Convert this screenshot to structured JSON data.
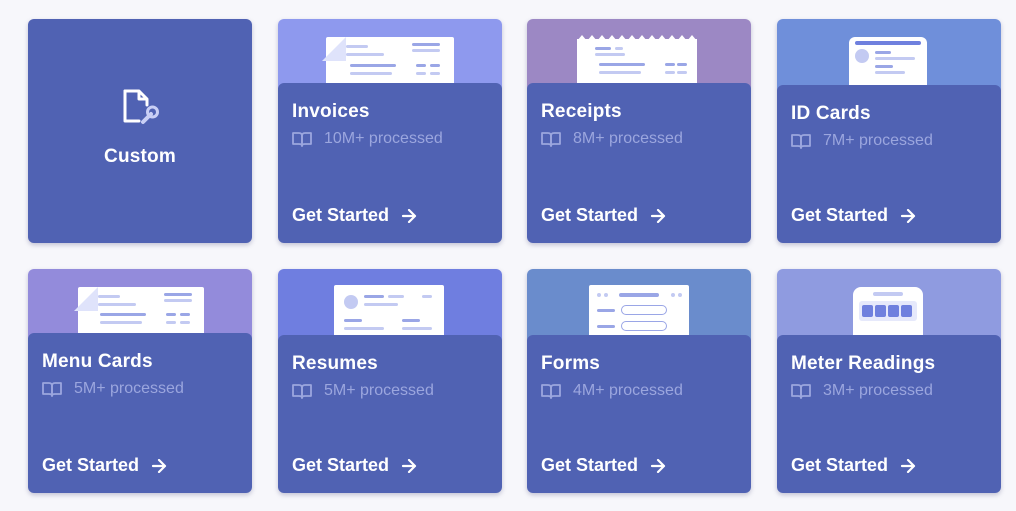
{
  "cards": [
    {
      "title": "Custom",
      "icon": "file-wrench-icon"
    },
    {
      "title": "Invoices",
      "count": "10M+ processed",
      "cta": "Get Started",
      "thumb_color": "#8e99ee"
    },
    {
      "title": "Receipts",
      "count": "8M+ processed",
      "cta": "Get Started",
      "thumb_color": "#9c88c4"
    },
    {
      "title": "ID Cards",
      "count": "7M+ processed",
      "cta": "Get Started",
      "thumb_color": "#6f8fda"
    },
    {
      "title": "Menu Cards",
      "count": "5M+ processed",
      "cta": "Get Started",
      "thumb_color": "#938bdb"
    },
    {
      "title": "Resumes",
      "count": "5M+ processed",
      "cta": "Get Started",
      "thumb_color": "#6f7ee0"
    },
    {
      "title": "Forms",
      "count": "4M+ processed",
      "cta": "Get Started",
      "thumb_color": "#6a8ccc"
    },
    {
      "title": "Meter Readings",
      "count": "3M+ processed",
      "cta": "Get Started",
      "thumb_color": "#8f9be0"
    }
  ],
  "colors": {
    "panel": "#5062b3",
    "muted_text": "#9ba6de",
    "doc_line": "#9aa6e6"
  }
}
